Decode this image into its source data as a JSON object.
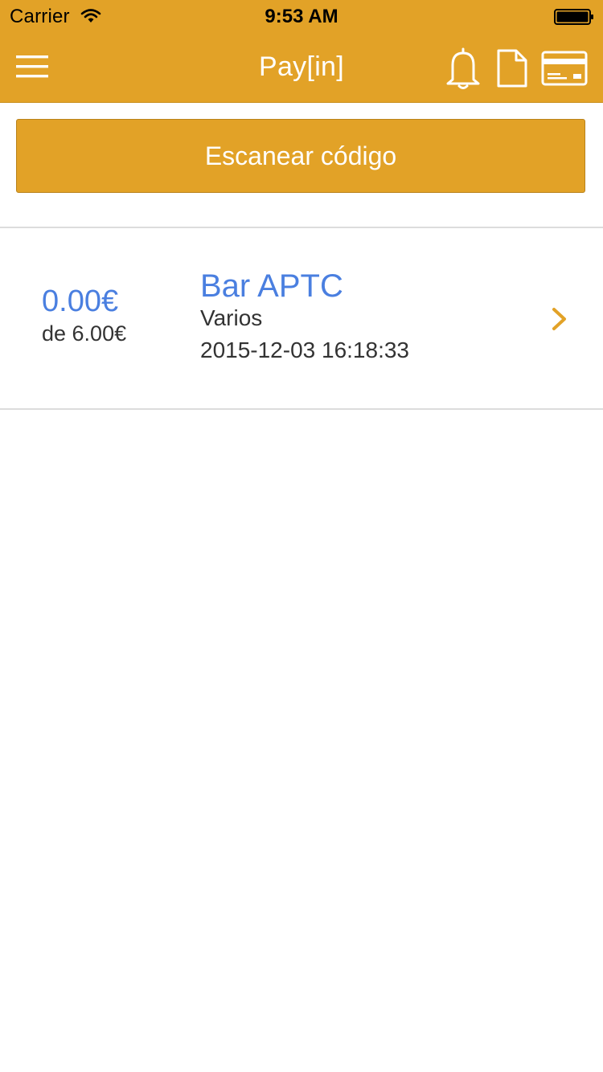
{
  "status_bar": {
    "carrier": "Carrier",
    "time": "9:53 AM"
  },
  "nav_bar": {
    "title": "Pay[in]",
    "background_color": "#E2A227",
    "icons": [
      "menu-icon",
      "bell-icon",
      "document-icon",
      "credit-card-icon"
    ]
  },
  "scan_button": {
    "label": "Escanear código"
  },
  "transactions": [
    {
      "paid_amount": "0.00€",
      "total_amount": "de 6.00€",
      "merchant": "Bar APTC",
      "category": "Varios",
      "datetime": "2015-12-03 16:18:33"
    }
  ],
  "colors": {
    "accent": "#E2A227",
    "link_blue": "#4A7FE0",
    "text": "#333333"
  }
}
